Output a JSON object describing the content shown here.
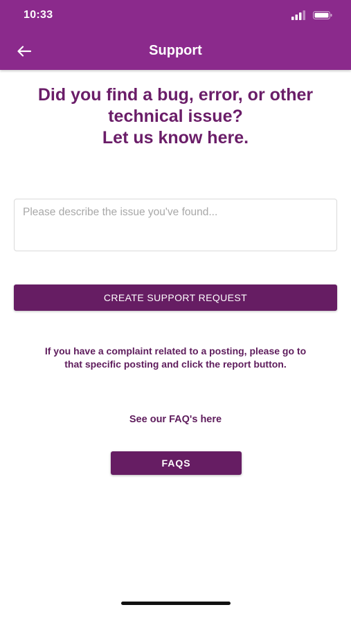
{
  "status_bar": {
    "time": "10:33"
  },
  "header": {
    "title": "Support",
    "back_icon": "arrow-left-icon",
    "background_color": "#8b2a8c"
  },
  "main": {
    "headline_line1": "Did you find a bug, error, or other",
    "headline_line2": "technical issue?",
    "headline_line3": "Let us know here.",
    "issue_input": {
      "value": "",
      "placeholder": "Please describe the issue you've found..."
    },
    "create_button_label": "CREATE SUPPORT REQUEST",
    "complaint_line1": "If you have a complaint related to a posting, please go to",
    "complaint_line2": "that specific posting and click the report button.",
    "faq_label": "See our FAQ's here",
    "faq_button_label": "FAQS"
  },
  "colors": {
    "accent": "#661d63",
    "headline_text": "#6a1d68"
  }
}
